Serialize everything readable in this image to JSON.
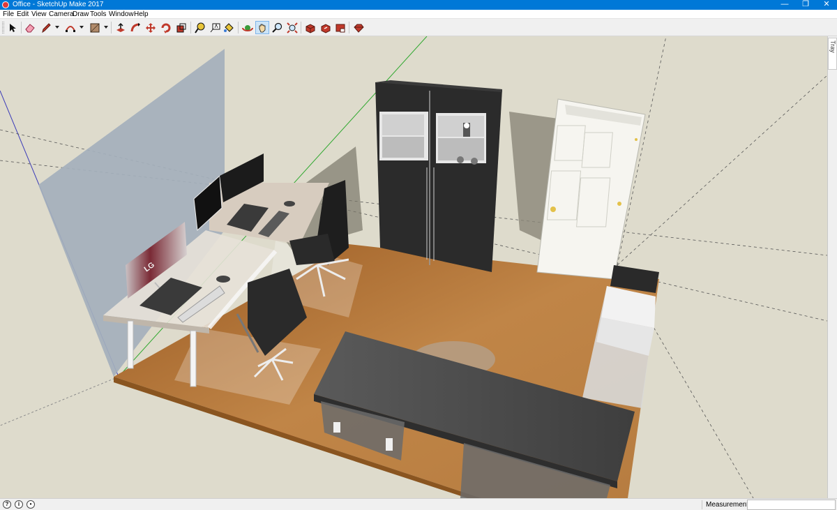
{
  "window": {
    "title": "Office - SketchUp Make 2017",
    "minimize_glyph": "—",
    "maximize_glyph": "❐",
    "close_glyph": "✕"
  },
  "menu": [
    "File",
    "Edit",
    "View",
    "Camera",
    "Draw",
    "Tools",
    "Window",
    "Help"
  ],
  "toolbar": {
    "buttons": [
      {
        "name": "select-tool-icon"
      },
      {
        "name": "eraser-tool-icon"
      },
      {
        "name": "pencil-line-tool-icon"
      },
      {
        "name": "arc-tool-icon"
      },
      {
        "name": "rectangle-tool-icon"
      },
      {
        "name": "push-pull-tool-icon"
      },
      {
        "name": "follow-me-tool-icon"
      },
      {
        "name": "move-tool-icon"
      },
      {
        "name": "rotate-tool-icon"
      },
      {
        "name": "scale-tool-icon"
      },
      {
        "name": "tape-measure-tool-icon"
      },
      {
        "name": "text-tool-icon"
      },
      {
        "name": "paint-bucket-tool-icon"
      },
      {
        "name": "orbit-tool-icon"
      },
      {
        "name": "pan-tool-icon",
        "active": true
      },
      {
        "name": "zoom-tool-icon"
      },
      {
        "name": "zoom-extents-tool-icon"
      },
      {
        "name": "3d-warehouse-icon"
      },
      {
        "name": "share-model-icon"
      },
      {
        "name": "extension-warehouse-icon"
      },
      {
        "name": "ruby-console-icon"
      }
    ]
  },
  "tray": {
    "label": "Default Tray"
  },
  "status": {
    "measurements_label": "Measurements",
    "measurements_value": ""
  },
  "colors": {
    "titlebar": "#0078d7",
    "viewport_bg": "#dedbcc",
    "floor_wood": "#b87a3a",
    "cabinet": "#2b2b2b",
    "door": "#f5f5f0",
    "desk_top": "#d8cdbf",
    "dark_desk": "#4e4e4e",
    "side_wall": "#a4b0bc"
  }
}
